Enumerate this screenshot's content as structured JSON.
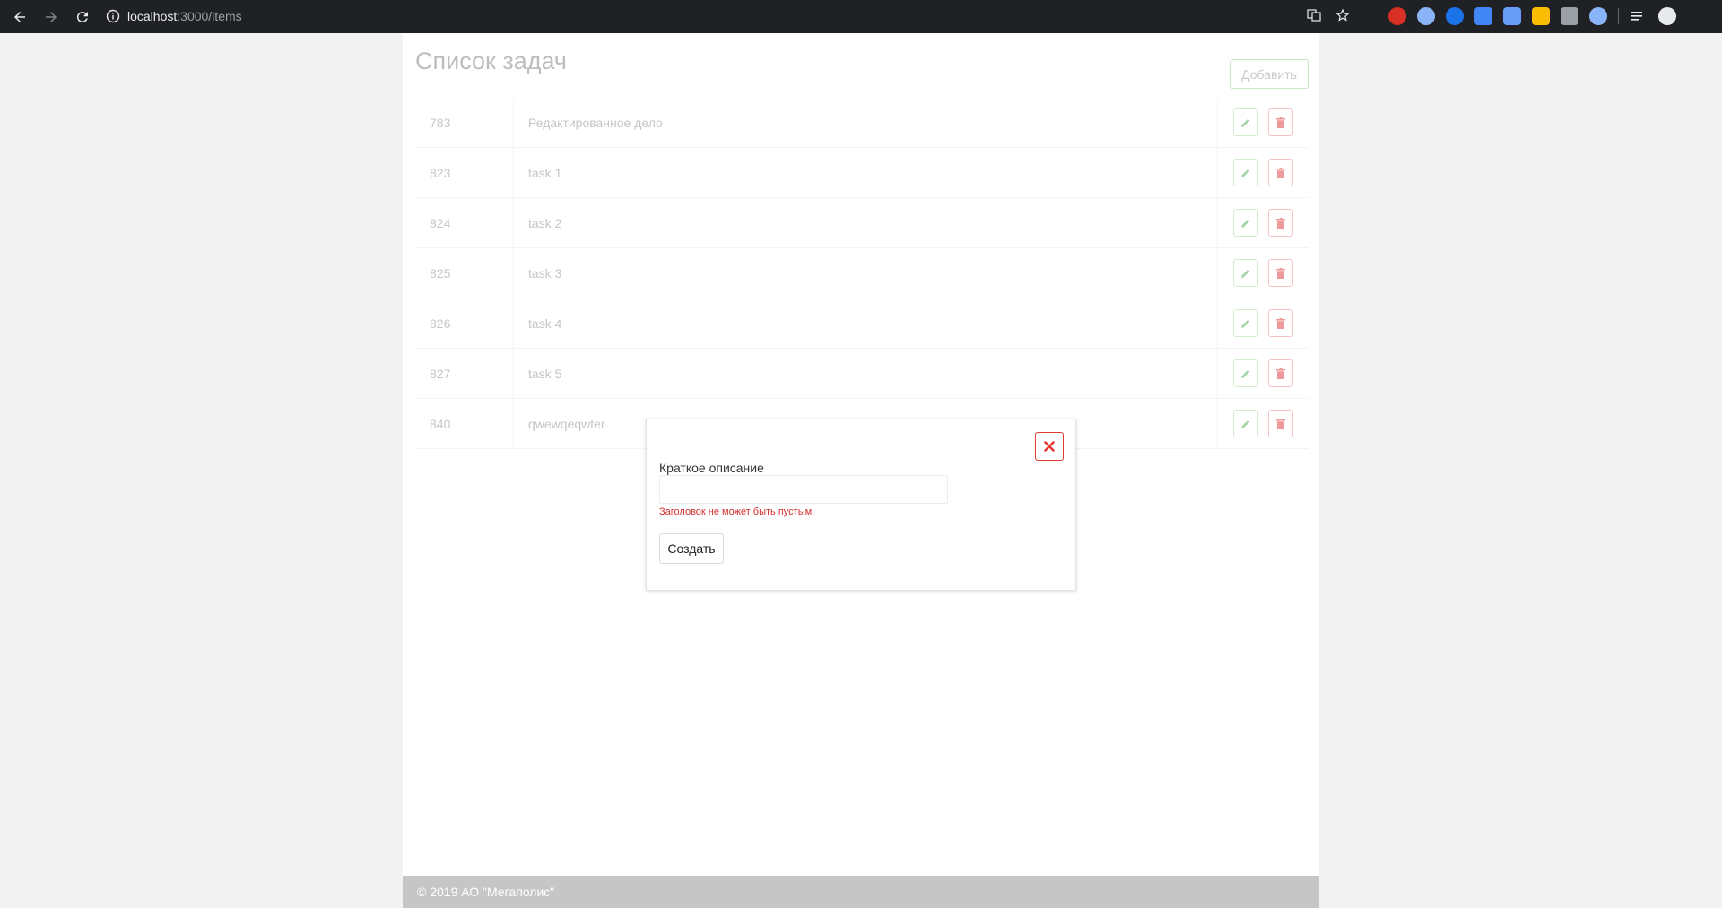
{
  "browser": {
    "url_host": "localhost",
    "url_path": ":3000/items"
  },
  "page": {
    "title": "Список задач",
    "add_label": "Добавить",
    "colors": {
      "edit": "#a5d6a7",
      "delete": "#ef9a9a",
      "error": "#d32f2f",
      "close": "#e53935"
    }
  },
  "items": [
    {
      "id": "783",
      "name": "Редактированное дело"
    },
    {
      "id": "823",
      "name": "task 1"
    },
    {
      "id": "824",
      "name": "task 2"
    },
    {
      "id": "825",
      "name": "task 3"
    },
    {
      "id": "826",
      "name": "task 4"
    },
    {
      "id": "827",
      "name": "task 5"
    },
    {
      "id": "840",
      "name": "qwewqeqwter"
    }
  ],
  "modal": {
    "field_label": "Краткое описание",
    "field_value": "",
    "error_text": "Заголовок не может быть пустым.",
    "submit_label": "Создать"
  },
  "footer": {
    "text": "© 2019 АО \"Мегаполис\""
  }
}
